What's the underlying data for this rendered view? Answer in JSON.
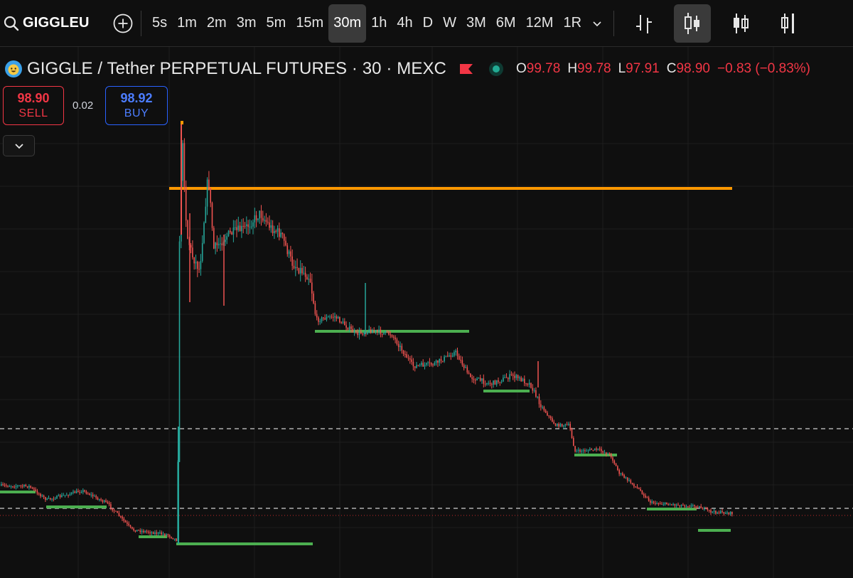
{
  "toolbar": {
    "symbol": "GIGGLEU",
    "timeframes": [
      "5s",
      "1m",
      "2m",
      "3m",
      "5m",
      "15m",
      "30m",
      "1h",
      "4h",
      "D",
      "W",
      "3M",
      "6M",
      "12M",
      "1R"
    ],
    "active_timeframe": "30m",
    "icons": [
      "search-icon",
      "add-symbol-icon",
      "chevron-down-icon",
      "bar-chart-icon",
      "candlestick-icon",
      "hollow-candle-icon",
      "columns-icon"
    ]
  },
  "legend": {
    "title": "GIGGLE / Tether PERPETUAL FUTURES · 30 · MEXC",
    "o_label": "O",
    "o": "99.78",
    "h_label": "H",
    "h": "99.78",
    "l_label": "L",
    "l": "97.91",
    "c_label": "C",
    "c": "98.90",
    "change": "−0.83 (−0.83%)"
  },
  "trade": {
    "sell_price": "98.90",
    "sell_label": "SELL",
    "spread": "0.02",
    "buy_price": "98.92",
    "buy_label": "BUY"
  },
  "colors": {
    "up": "#26a69a",
    "down": "#ef5350",
    "resistance": "#ff9800",
    "support": "#4caf50",
    "background": "#0f0f0f"
  }
}
